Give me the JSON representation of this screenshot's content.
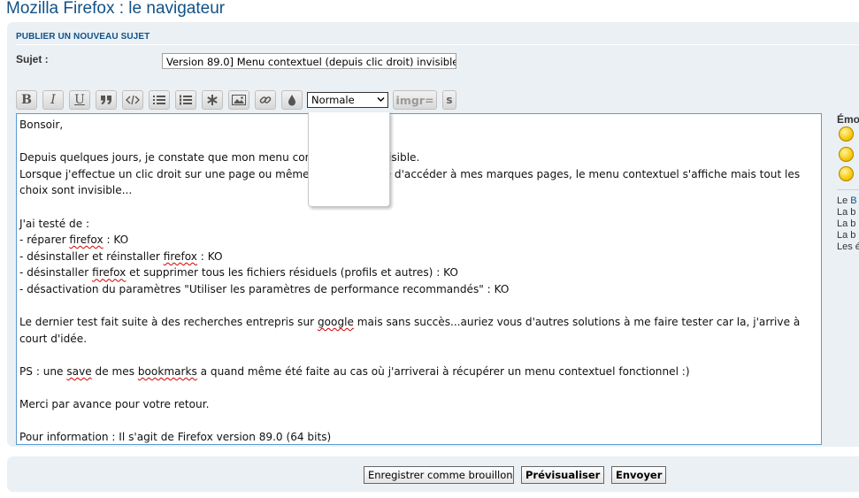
{
  "page": {
    "title": "Mozilla Firefox : le navigateur"
  },
  "form": {
    "section_header": "PUBLIER UN NOUVEAU SUJET",
    "subject_label": "Sujet :",
    "subject_value": "Version 89.0] Menu contextuel (depuis clic droit) invisible"
  },
  "toolbar": {
    "buttons": [
      {
        "label": "B",
        "icon": "bold-icon"
      },
      {
        "label": "I",
        "icon": "italic-icon"
      },
      {
        "label": "U",
        "icon": "underline-icon"
      },
      {
        "label": "",
        "icon": "quote-icon"
      },
      {
        "label": "",
        "icon": "code-icon"
      },
      {
        "label": "",
        "icon": "bullet-list-icon"
      },
      {
        "label": "",
        "icon": "numbered-list-icon"
      },
      {
        "label": "",
        "icon": "asterisk-icon"
      },
      {
        "label": "",
        "icon": "image-icon"
      },
      {
        "label": "",
        "icon": "link-icon"
      },
      {
        "label": "",
        "icon": "color-drop-icon"
      }
    ],
    "font_size_selected": "Normale",
    "imgr_label": "imgr=",
    "s_label": "s"
  },
  "editor": {
    "greeting": "Bonsoir,",
    "p1_a": "Depuis quelques jours, je constate que mon menu contextuel est invisible.",
    "p1_b": "Lorsque j'effectue un clic droit sur une page ou même quand je tente d'accéder à mes marques pages, le menu contextuel s'affiche mais tout les choix sont invisible...",
    "tested_intro": "J'ai testé de :",
    "t1_a": "- réparer ",
    "t1_word": "firefox",
    "t1_b": " : KO",
    "t2_a": "- désinstaller et réinstaller ",
    "t2_word": "firefox",
    "t2_b": " : KO",
    "t3_a": "- désinstaller ",
    "t3_word": "firefox",
    "t3_b": " et supprimer tous les fichiers résiduels (profils et autres) : KO",
    "t4": "- désactivation du paramètres \"Utiliser les paramètres de performance recommandés\" : KO",
    "p3_a": "Le dernier test fait suite à des recherches entrepris sur ",
    "p3_word": "google",
    "p3_b": " mais sans succès...auriez vous d'autres solutions à me faire tester car la, j'arrive à court d'idée.",
    "ps_a": "PS : une ",
    "ps_word1": "save",
    "ps_b": " de mes ",
    "ps_word2": "bookmarks",
    "ps_c": " a quand même été faite au cas où j'arriverai à récupérer un menu contextuel fonctionnel :)",
    "thanks": "Merci par avance pour votre retour.",
    "info": "Pour information : Il s'agit de Firefox version 89.0 (64 bits)"
  },
  "sidebar": {
    "emoticons_title": "Émo",
    "links": [
      {
        "prefix": "Le ",
        "rest": "B"
      },
      {
        "prefix": "La b",
        "rest": ""
      },
      {
        "prefix": "La b",
        "rest": ""
      },
      {
        "prefix": "La b",
        "rest": ""
      },
      {
        "prefix": "Les é",
        "rest": ""
      }
    ]
  },
  "actions": {
    "draft": "Enregistrer comme brouillon",
    "preview": "Prévisualiser",
    "send": "Envoyer"
  }
}
